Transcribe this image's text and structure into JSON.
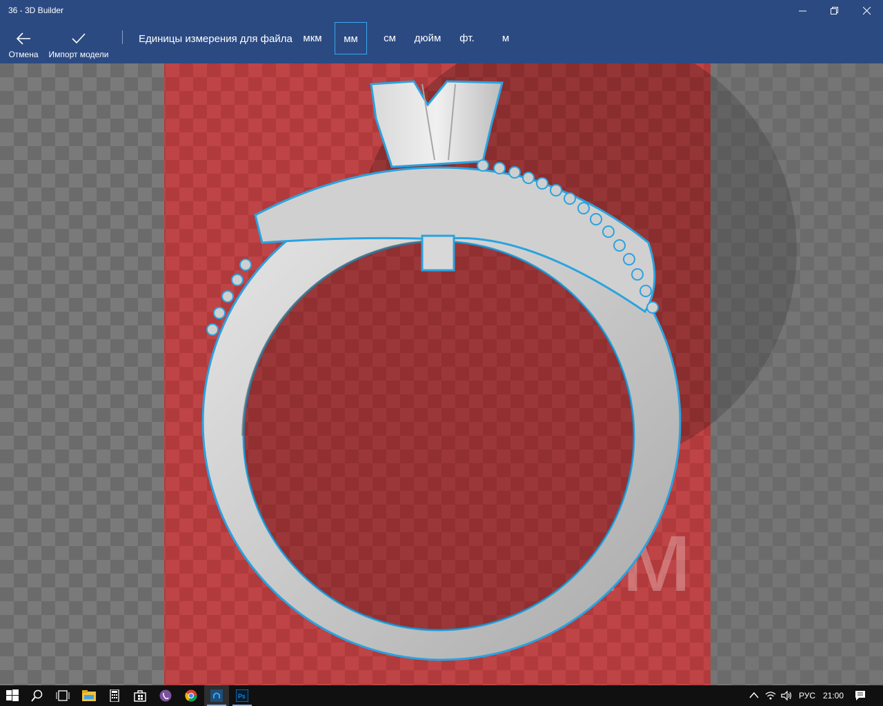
{
  "window": {
    "title": "36 - 3D Builder"
  },
  "commands": {
    "cancel_label": "Отмена",
    "import_label": "Импорт модели"
  },
  "units": {
    "label": "Единицы измерения для файла",
    "options": [
      "мкм",
      "мм",
      "см",
      "дюйм",
      "фт.",
      "м"
    ],
    "selected": "мм"
  },
  "viewport": {
    "size_readout": "0 мм",
    "bed_color": "#c0393b",
    "selection_color": "#29a3e0"
  },
  "taskbar": {
    "language": "РУС",
    "time": "21:00",
    "apps": [
      "start-icon",
      "search-icon",
      "task-view-icon",
      "file-explorer-icon",
      "calculator-icon",
      "store-icon",
      "viber-icon",
      "chrome-icon",
      "3d-builder-icon",
      "photoshop-icon"
    ],
    "photoshop_label": "Ps"
  }
}
